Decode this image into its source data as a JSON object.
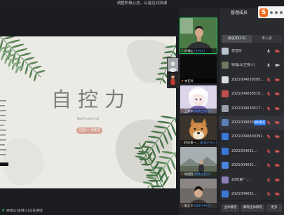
{
  "window": {
    "title": "调整积极心态，从容应对网课"
  },
  "slide": {
    "title": "自控力",
    "subtitle": "Self-control",
    "presenter": "汇报人：徐某某",
    "background": "#ebeae5",
    "accent": "#d6a294"
  },
  "status": {
    "speaking_text": "徐福山(主持人)正在讲话"
  },
  "thumbnails": [
    {
      "name": "徐福山",
      "tag": "(主持人)",
      "speaking": true
    },
    {
      "name": "李亚玲",
      "tag": ""
    },
    {
      "name": "王润华",
      "tag": "(联席主持人)"
    },
    {
      "name": "20年第一…",
      "tag": "(联席主持人)"
    },
    {
      "name": "陈国胜",
      "tag": "(联席主持人)"
    },
    {
      "name": "陈正华",
      "tag": "(联席主持人)"
    }
  ],
  "ime_toolbar": {
    "logo": "S"
  },
  "members": {
    "header": "管理成员",
    "tabs": [
      {
        "label": "会议中(13)",
        "selected": true
      },
      {
        "label": "未入会",
        "selected": false
      }
    ],
    "hover_button": "解除静音",
    "list": [
      {
        "name": "李亚玲",
        "avatar_color": "#b7c3cf",
        "mic": "on",
        "camera": "off"
      },
      {
        "name": "徐福山(主持人)",
        "avatar_color": "#6d7a62",
        "mic": "on",
        "camera": "on"
      },
      {
        "name": "2021004030505…",
        "avatar_color": "#d9dde3",
        "mic": "muted",
        "camera": "off"
      },
      {
        "name": "2021004030516…",
        "avatar_color": "#c0504d",
        "mic": "muted",
        "camera": "off"
      },
      {
        "name": "2021004030517…",
        "avatar_color": "#9aa0a8",
        "mic": "muted",
        "camera": "off"
      },
      {
        "name": "2021004030…",
        "avatar_color": "#5a7fb5",
        "mic": "muted",
        "camera": "off",
        "hover": true
      },
      {
        "name": "20210040300391…",
        "avatar_color": "#3a78d8",
        "mic": "muted",
        "camera": "off"
      },
      {
        "name": "2021004031…",
        "avatar_color": "#3a78d8",
        "mic": "muted",
        "camera": "off"
      },
      {
        "name": "2021004031…",
        "avatar_color": "#4a86e0",
        "mic": "muted",
        "camera": "off"
      },
      {
        "name": "20年第一…",
        "avatar_color": "#8e7fb8",
        "mic": "muted",
        "camera": "off"
      },
      {
        "name": "2021004031…",
        "avatar_color": "#3a78d8",
        "mic": "muted",
        "camera": "off"
      }
    ],
    "footer": {
      "mute_all": "全体静音",
      "unmute_all": "解除全体静音",
      "more": "更多"
    }
  },
  "colors": {
    "speaking_border": "#22c55e",
    "muted": "#e25555",
    "primary": "#2f7bf5",
    "tag": "#4d9bff"
  }
}
